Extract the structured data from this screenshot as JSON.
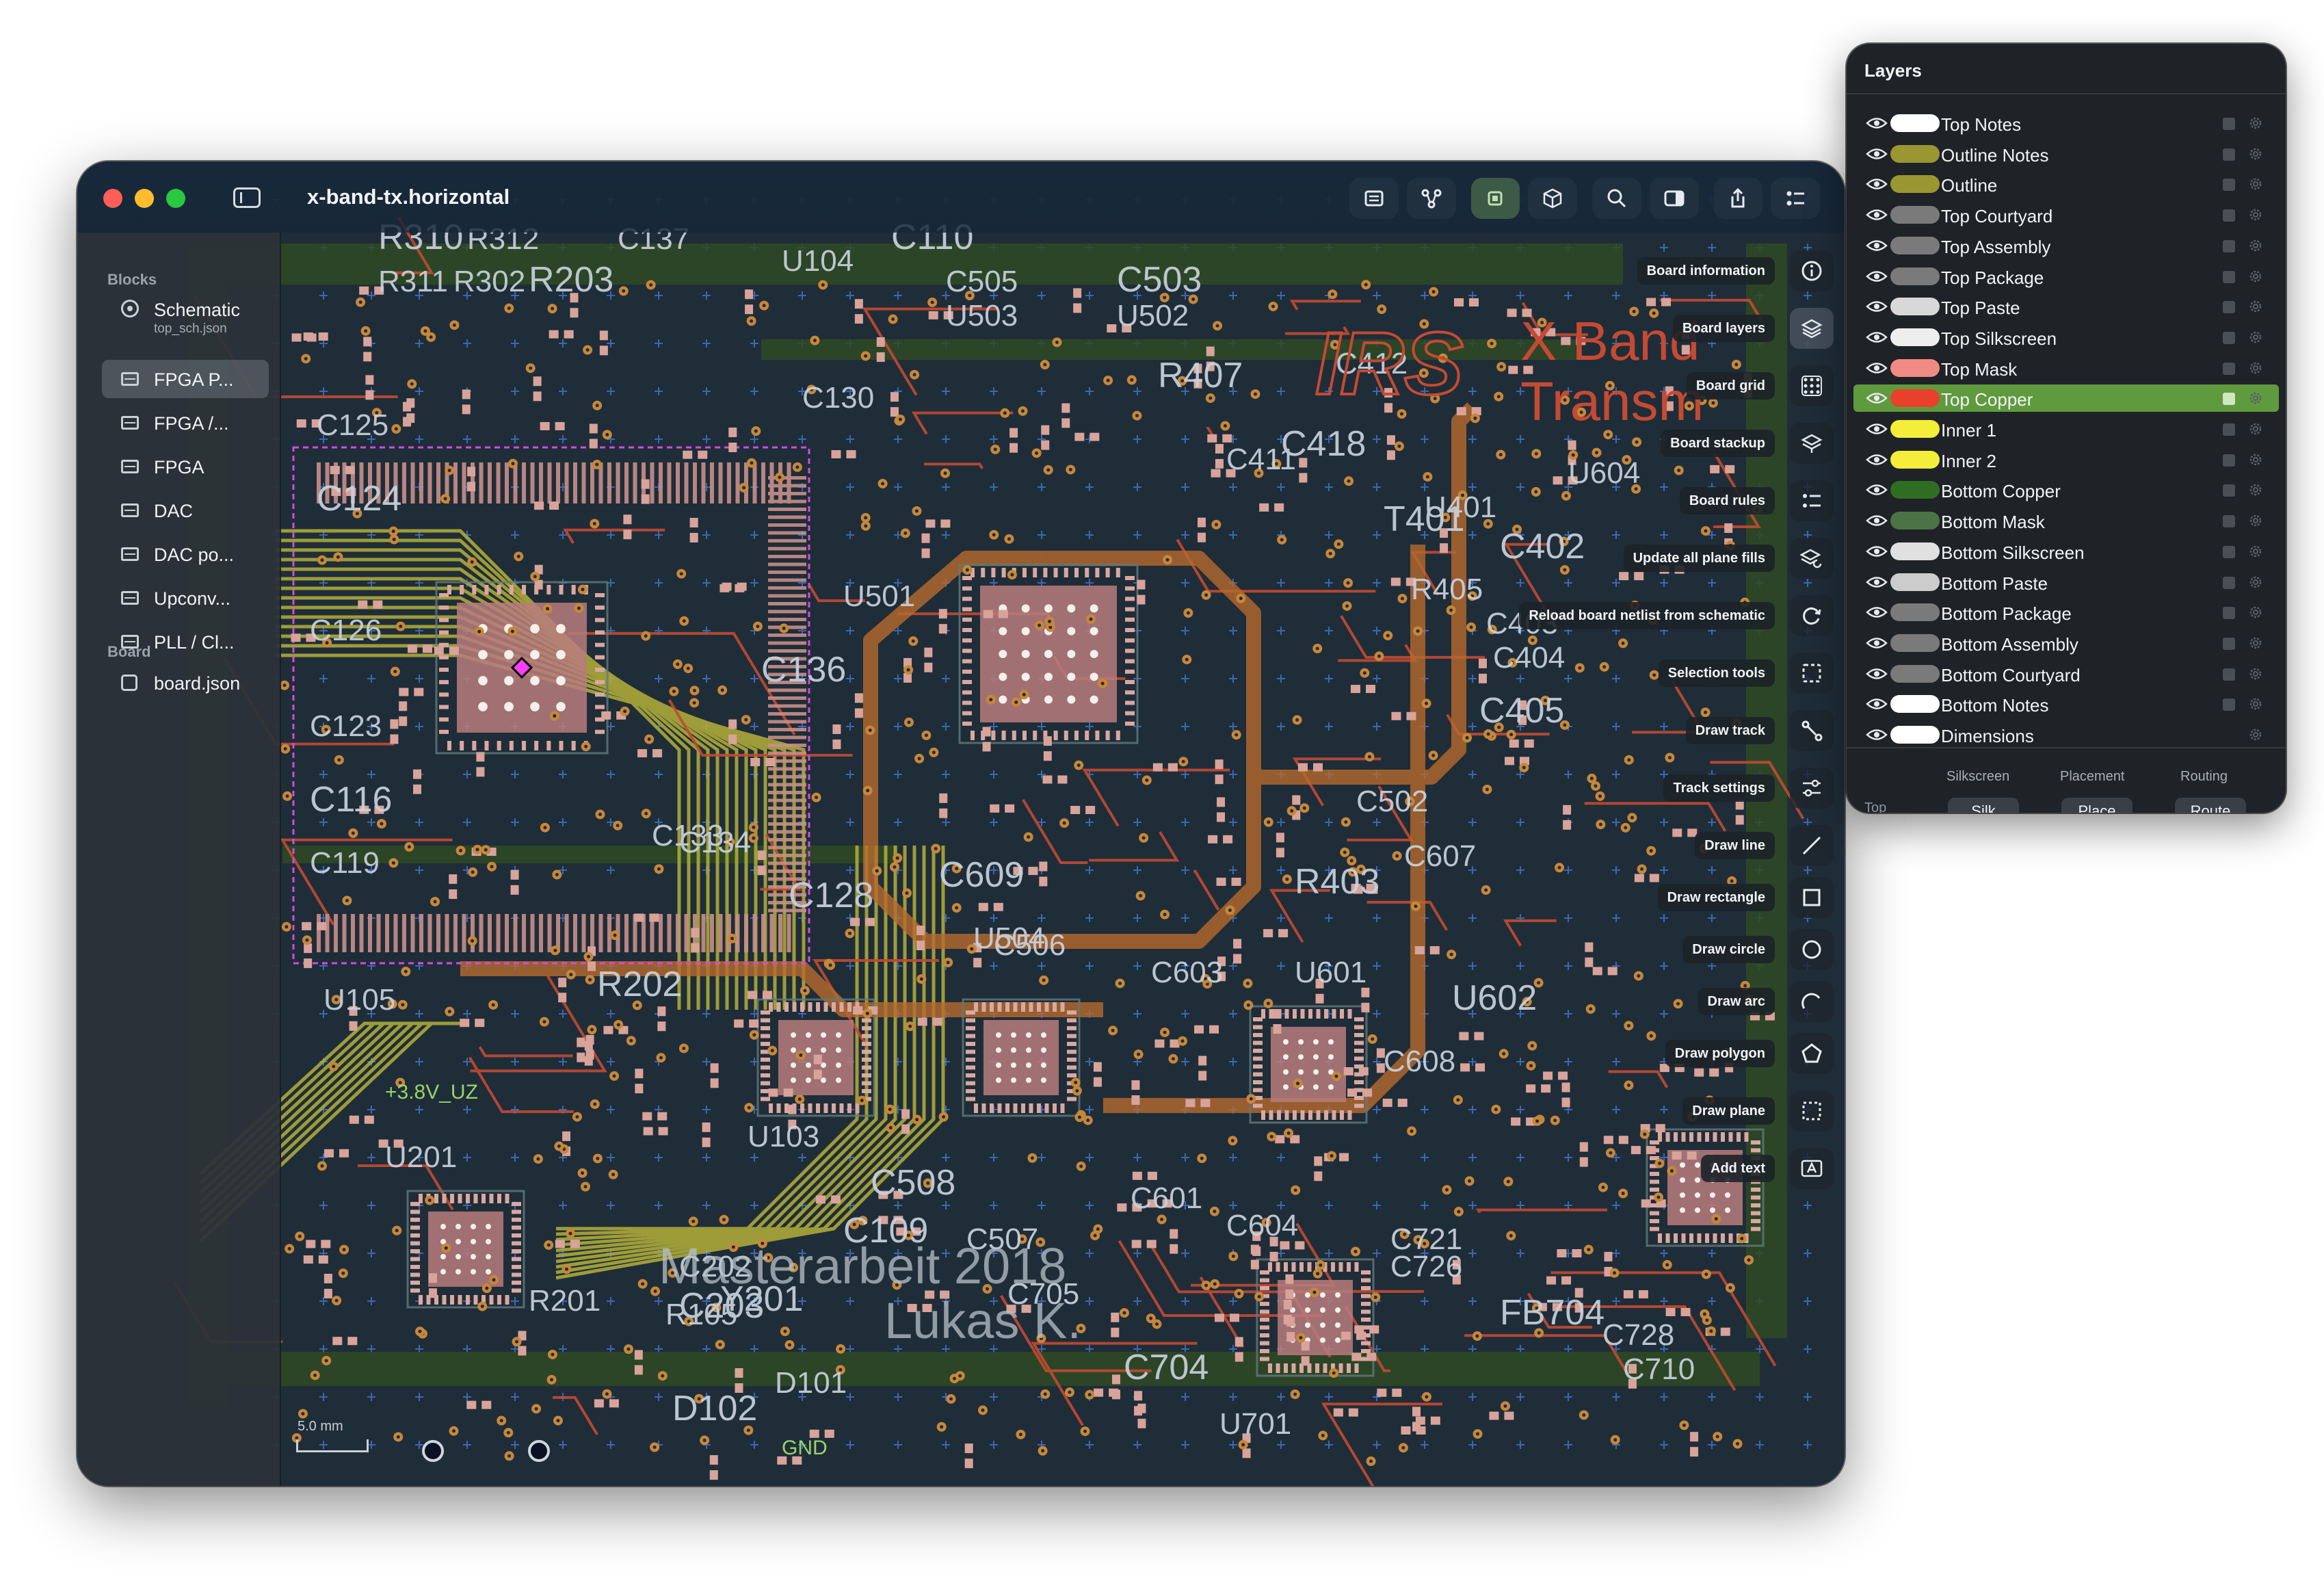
{
  "window": {
    "title": "x-band-tx.horizontal"
  },
  "toolbar": {
    "buttons": [
      {
        "icon": "list-icon",
        "name": "list-button"
      },
      {
        "icon": "netlist-icon",
        "name": "netlist-button"
      },
      {
        "icon": "chip-icon",
        "name": "board-view-button",
        "active": true
      },
      {
        "icon": "cube-icon",
        "name": "3d-view-button"
      },
      {
        "icon": "search-icon",
        "name": "search-button"
      },
      {
        "icon": "inspector-icon",
        "name": "inspector-button"
      },
      {
        "icon": "share-icon",
        "name": "share-button"
      },
      {
        "icon": "settings-list-icon",
        "name": "settings-button"
      }
    ]
  },
  "sidebar": {
    "blocks_label": "Blocks",
    "schematic": {
      "label": "Schematic",
      "file": "top_sch.json"
    },
    "items": [
      {
        "label": "FPGA P...",
        "selected": true
      },
      {
        "label": "FPGA /..."
      },
      {
        "label": "FPGA"
      },
      {
        "label": "DAC"
      },
      {
        "label": "DAC po..."
      },
      {
        "label": "Upconv..."
      },
      {
        "label": "PLL / Cl..."
      }
    ],
    "board_label": "Board",
    "board_file": "board.json"
  },
  "tools": [
    {
      "label": "Board information",
      "icon": "info-icon"
    },
    {
      "label": "Board layers",
      "icon": "layers-icon",
      "highlight": true
    },
    {
      "label": "Board grid",
      "icon": "grid-icon"
    },
    {
      "label": "Board stackup",
      "icon": "stackup-icon"
    },
    {
      "label": "Board rules",
      "icon": "rules-icon"
    },
    {
      "label": "Update all plane fills",
      "icon": "plane-fill-icon"
    },
    {
      "label": "Reload board netlist from schematic",
      "icon": "reload-icon"
    },
    {
      "label": "Selection tools",
      "icon": "selection-icon"
    },
    {
      "label": "Draw track",
      "icon": "track-icon"
    },
    {
      "label": "Track settings",
      "icon": "sliders-icon"
    },
    {
      "label": "Draw line",
      "icon": "line-icon"
    },
    {
      "label": "Draw rectangle",
      "icon": "rectangle-icon"
    },
    {
      "label": "Draw circle",
      "icon": "circle-icon"
    },
    {
      "label": "Draw arc",
      "icon": "arc-icon"
    },
    {
      "label": "Draw polygon",
      "icon": "polygon-icon"
    },
    {
      "label": "Draw plane",
      "icon": "plane-icon"
    },
    {
      "label": "Add text",
      "icon": "text-icon"
    }
  ],
  "scale": {
    "label": "5.0 mm"
  },
  "pcb": {
    "logo_text": "IRS",
    "title_lines": [
      "X Band",
      "Transm"
    ],
    "credit_lines": [
      "Masterarbeit 2018",
      "Lukas K."
    ],
    "refdes": [
      "R310",
      "R312",
      "C137",
      "C110",
      "R311",
      "R302",
      "R203",
      "U104",
      "C505",
      "C503",
      "U503",
      "U502",
      "R407",
      "C130",
      "U604",
      "T401",
      "C133",
      "C134",
      "C136",
      "C502",
      "C607",
      "C609",
      "U504",
      "C603",
      "C128",
      "C601",
      "C604",
      "C109",
      "C507",
      "C705",
      "C203",
      "C202",
      "R201",
      "Y201",
      "U201",
      "U105",
      "R202",
      "U103",
      "U601",
      "U602",
      "C721",
      "C726",
      "FB704",
      "C728",
      "C710",
      "C704",
      "U701",
      "D101",
      "D102",
      "R105",
      "C506",
      "C508",
      "C608",
      "U401",
      "C402",
      "C403",
      "C404",
      "C405",
      "R405",
      "C125",
      "C124",
      "C126",
      "C123",
      "C116",
      "C119",
      "U501",
      "R403",
      "C411",
      "C412",
      "C418"
    ],
    "net_labels": [
      "+3.8V_UZ",
      "GND"
    ]
  },
  "layers_panel": {
    "title": "Layers",
    "layers": [
      {
        "name": "Top Notes",
        "color": "#ffffff"
      },
      {
        "name": "Outline Notes",
        "color": "#9a9632"
      },
      {
        "name": "Outline",
        "color": "#9a9632"
      },
      {
        "name": "Top Courtyard",
        "color": "#7a7a7a"
      },
      {
        "name": "Top Assembly",
        "color": "#7a7a7a"
      },
      {
        "name": "Top Package",
        "color": "#7a7a7a"
      },
      {
        "name": "Top Paste",
        "color": "#d8d8d8"
      },
      {
        "name": "Top Silkscreen",
        "color": "#eeeeee"
      },
      {
        "name": "Top Mask",
        "color": "#f08a84"
      },
      {
        "name": "Top Copper",
        "color": "#e8402a",
        "selected": true
      },
      {
        "name": "Inner 1",
        "color": "#f4ee3a"
      },
      {
        "name": "Inner 2",
        "color": "#f4ee3a"
      },
      {
        "name": "Bottom Copper",
        "color": "#2f6e22"
      },
      {
        "name": "Bottom Mask",
        "color": "#4c7346"
      },
      {
        "name": "Bottom Silkscreen",
        "color": "#e0e0e0"
      },
      {
        "name": "Bottom Paste",
        "color": "#cccccc"
      },
      {
        "name": "Bottom Package",
        "color": "#7a7a7a"
      },
      {
        "name": "Bottom Assembly",
        "color": "#7a7a7a"
      },
      {
        "name": "Bottom Courtyard",
        "color": "#7a7a7a"
      },
      {
        "name": "Bottom Notes",
        "color": "#ffffff"
      },
      {
        "name": "Dimensions",
        "color": "#ffffff",
        "no_checkbox": true
      }
    ],
    "footer": {
      "side_label": "Top",
      "columns": [
        {
          "header": "Silkscreen",
          "button": "Silk"
        },
        {
          "header": "Placement",
          "button": "Place"
        },
        {
          "header": "Routing",
          "button": "Route"
        }
      ]
    }
  }
}
